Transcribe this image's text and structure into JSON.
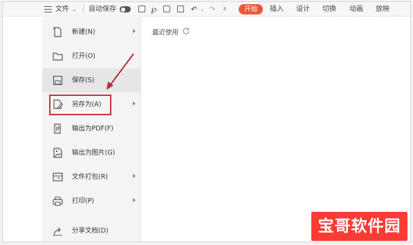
{
  "toolbar": {
    "file_label": "文件",
    "autosave_label": "自动保存",
    "tabs": [
      "开始",
      "插入",
      "设计",
      "切换",
      "动画",
      "放映"
    ]
  },
  "file_menu": {
    "items": [
      {
        "label": "新建(N)",
        "icon": "new-file-icon",
        "has_submenu": true
      },
      {
        "label": "打开(O)",
        "icon": "folder-open-icon",
        "has_submenu": false
      },
      {
        "label": "保存(S)",
        "icon": "save-icon",
        "has_submenu": false,
        "hovered": true
      },
      {
        "label": "另存为(A)",
        "icon": "save-as-icon",
        "has_submenu": true,
        "highlighted": true
      },
      {
        "label": "输出为PDF(F)",
        "icon": "export-pdf-icon",
        "has_submenu": false
      },
      {
        "label": "输出为图片(G)",
        "icon": "export-image-icon",
        "has_submenu": false
      },
      {
        "label": "文件打包(R)",
        "icon": "package-icon",
        "has_submenu": true
      },
      {
        "label": "打印(P)",
        "icon": "print-icon",
        "has_submenu": true
      },
      {
        "label": "分享文档(D)",
        "icon": "share-icon",
        "has_submenu": false
      }
    ]
  },
  "recent": {
    "label": "最近使用"
  },
  "watermark": {
    "text": "宝哥软件园"
  },
  "colors": {
    "accent": "#f0573a",
    "highlight_box": "#c8343a",
    "watermark_bg": "#ff3b34"
  }
}
